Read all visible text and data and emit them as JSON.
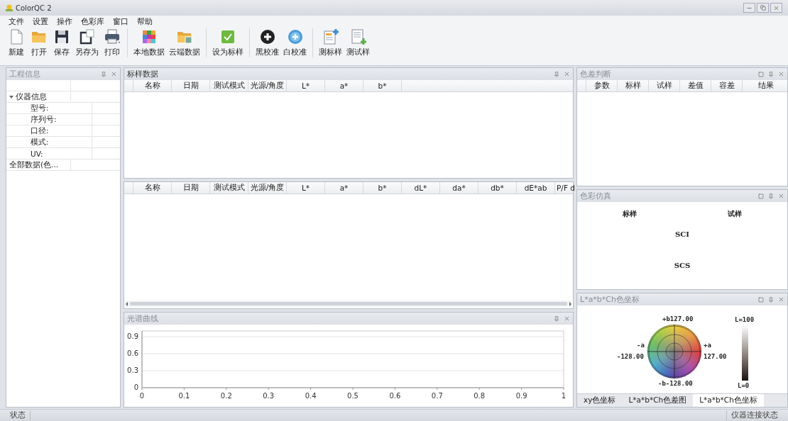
{
  "window": {
    "title": "ColorQC 2"
  },
  "menu": [
    "文件",
    "设置",
    "操作",
    "色彩库",
    "窗口",
    "帮助"
  ],
  "toolbar": {
    "groups": [
      [
        {
          "label": "新建"
        },
        {
          "label": "打开"
        },
        {
          "label": "保存"
        },
        {
          "label": "另存为"
        },
        {
          "label": "打印"
        }
      ],
      [
        {
          "label": "本地数据"
        },
        {
          "label": "云端数据"
        }
      ],
      [
        {
          "label": "设为标样"
        }
      ],
      [
        {
          "label": "黑校准"
        },
        {
          "label": "白校准"
        }
      ],
      [
        {
          "label": "测标样"
        },
        {
          "label": "测试样"
        }
      ]
    ]
  },
  "project_panel": {
    "title": "工程信息",
    "controls": [
      {
        "kind": "pin"
      },
      {
        "kind": "close"
      }
    ],
    "tree": [
      {
        "label": "仪器信息",
        "expanded": true,
        "children": [
          {
            "label": "型号:"
          },
          {
            "label": "序列号:"
          },
          {
            "label": "口径:"
          },
          {
            "label": "模式:"
          },
          {
            "label": "UV:"
          }
        ]
      },
      {
        "label": "全部数据(色..."
      }
    ]
  },
  "standard_panel": {
    "title": "标样数据",
    "controls": [
      {
        "kind": "pin"
      },
      {
        "kind": "close"
      }
    ],
    "columns": [
      "名称",
      "日期",
      "测试模式",
      "光源/角度",
      "L*",
      "a*",
      "b*"
    ]
  },
  "sample_grid": {
    "columns": [
      "名称",
      "日期",
      "测试模式",
      "光源/角度",
      "L*",
      "a*",
      "b*",
      "dL*",
      "da*",
      "db*",
      "dE*ab",
      "P/F d"
    ]
  },
  "spectrum_panel": {
    "title": "光谱曲线",
    "controls": [
      {
        "kind": "pin"
      },
      {
        "kind": "close"
      }
    ],
    "chart_data": {
      "type": "line",
      "grid": true,
      "xlim": [
        0,
        1
      ],
      "ylim": [
        0,
        1
      ],
      "xticks": [
        0,
        0.1,
        0.2,
        0.3,
        0.4,
        0.5,
        0.6,
        0.7,
        0.8,
        0.9,
        1
      ],
      "yticks": [
        0,
        0.3,
        0.6,
        0.9
      ]
    }
  },
  "difference_panel": {
    "title": "色差判断",
    "controls": [
      {
        "kind": "maximize"
      },
      {
        "kind": "pin"
      },
      {
        "kind": "close"
      }
    ],
    "columns": [
      "参数",
      "标样",
      "试样",
      "差值",
      "容差",
      "结果"
    ]
  },
  "simulation_panel": {
    "title": "色彩仿真",
    "controls": [
      {
        "kind": "maximize"
      },
      {
        "kind": "pin"
      },
      {
        "kind": "close"
      }
    ],
    "standard_label": "标样",
    "sample_label": "试样",
    "modes": [
      "SCI",
      "SCS"
    ]
  },
  "coordinate_panel": {
    "title": "L*a*b*Ch色坐标",
    "controls": [
      {
        "kind": "maximize"
      },
      {
        "kind": "pin"
      },
      {
        "kind": "close"
      }
    ],
    "wheel": {
      "plus_b": "+b127.00",
      "minus_a": "-a",
      "plus_a": "+a",
      "a_min": "-128.00",
      "a_max": "127.00",
      "minus_b": "-b-128.00",
      "l_max": "L=100",
      "l_min": "L=0"
    },
    "tabs": [
      {
        "label": "xy色坐标",
        "selected": false
      },
      {
        "label": "L*a*b*Ch色差图",
        "selected": false
      },
      {
        "label": "L*a*b*Ch色坐标",
        "selected": true
      }
    ]
  },
  "status_bar": {
    "left": "状态",
    "right": "仪器连接状态"
  }
}
